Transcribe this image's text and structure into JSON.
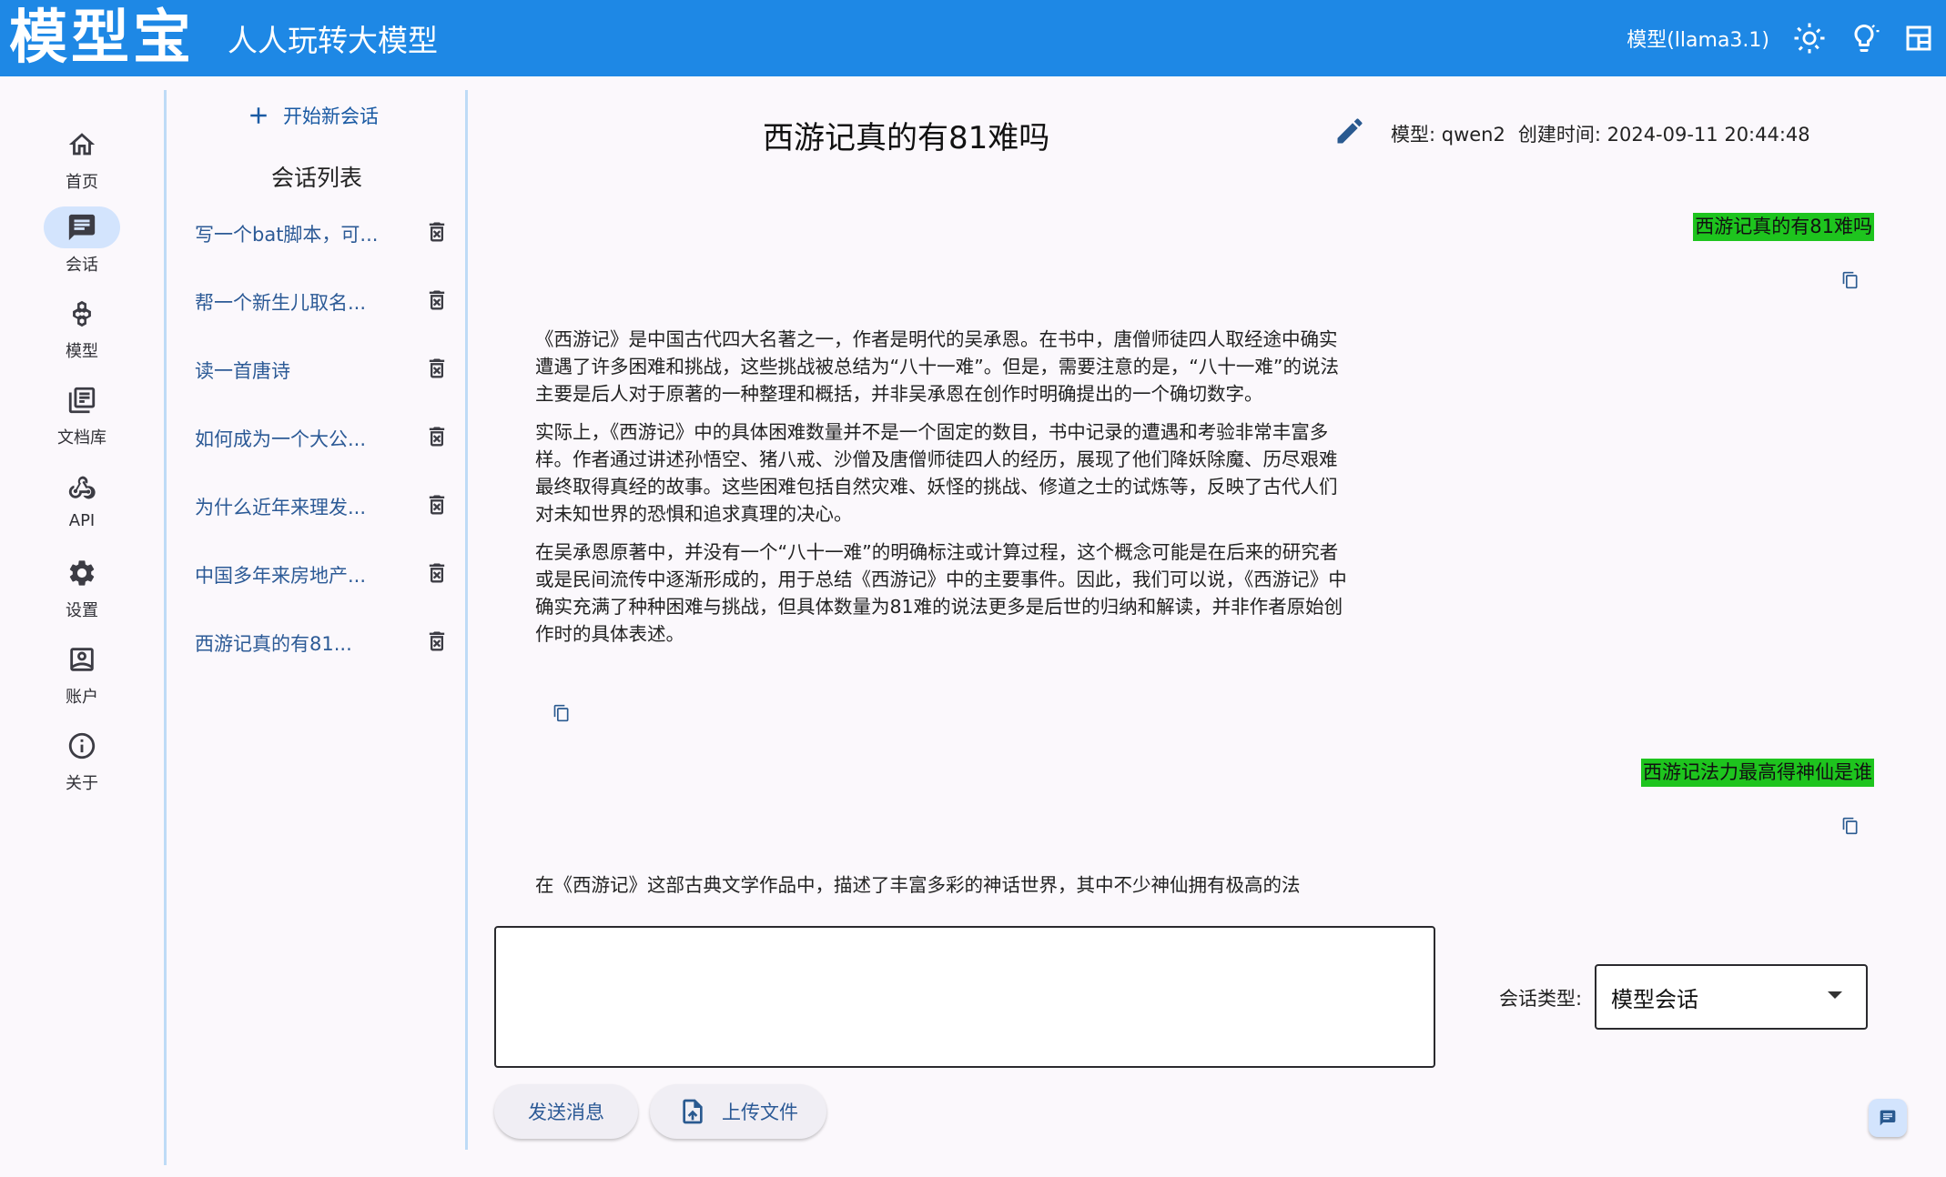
{
  "header": {
    "brand": "模型宝",
    "slogan": "人人玩转大模型",
    "model_label": "模型(llama3.1)"
  },
  "nav": {
    "items": [
      {
        "label": "首页",
        "icon": "home-icon"
      },
      {
        "label": "会话",
        "icon": "chat-icon",
        "active": true
      },
      {
        "label": "模型",
        "icon": "hub-icon"
      },
      {
        "label": "文档库",
        "icon": "library-icon"
      },
      {
        "label": "API",
        "icon": "webhook-icon"
      },
      {
        "label": "设置",
        "icon": "gear-icon"
      },
      {
        "label": "账户",
        "icon": "account-icon"
      },
      {
        "label": "关于",
        "icon": "info-icon"
      }
    ]
  },
  "conversations": {
    "new_label": "开始新会话",
    "title": "会话列表",
    "items": [
      {
        "label": "写一个bat脚本，可..."
      },
      {
        "label": "帮一个新生儿取名..."
      },
      {
        "label": "读一首唐诗"
      },
      {
        "label": "如何成为一个大公..."
      },
      {
        "label": "为什么近年来理发..."
      },
      {
        "label": "中国多年来房地产..."
      },
      {
        "label": "西游记真的有81..."
      }
    ]
  },
  "chat": {
    "title": "西游记真的有81难吗",
    "model": "模型: qwen2",
    "created": "创建时间: 2024-09-11 20:44:48",
    "messages": [
      {
        "role": "user",
        "text": "西游记真的有81难吗"
      },
      {
        "role": "assistant",
        "paragraphs": [
          "《西游记》是中国古代四大名著之一，作者是明代的吴承恩。在书中，唐僧师徒四人取经途中确实遭遇了许多困难和挑战，这些挑战被总结为“八十一难”。但是，需要注意的是，“八十一难”的说法主要是后人对于原著的一种整理和概括，并非吴承恩在创作时明确提出的一个确切数字。",
          "实际上，《西游记》中的具体困难数量并不是一个固定的数目，书中记录的遭遇和考验非常丰富多样。作者通过讲述孙悟空、猪八戒、沙僧及唐僧师徒四人的经历，展现了他们降妖除魔、历尽艰难最终取得真经的故事。这些困难包括自然灾难、妖怪的挑战、修道之士的试炼等，反映了古代人们对未知世界的恐惧和追求真理的决心。",
          "在吴承恩原著中，并没有一个“八十一难”的明确标注或计算过程，这个概念可能是在后来的研究者或是民间流传中逐渐形成的，用于总结《西游记》中的主要事件。因此，我们可以说，《西游记》中确实充满了种种困难与挑战，但具体数量为81难的说法更多是后世的归纳和解读，并非作者原始创作时的具体表述。"
        ]
      },
      {
        "role": "user",
        "text": "西游记法力最高得神仙是谁"
      },
      {
        "role": "assistant",
        "paragraphs": [
          "在《西游记》这部古典文学作品中，描述了丰富多彩的神话世界，其中不少神仙拥有极高的法"
        ]
      }
    ]
  },
  "composer": {
    "value": "",
    "placeholder": "",
    "type_label": "会话类型:",
    "type_value": "模型会话",
    "send_label": "发送消息",
    "upload_label": "上传文件"
  }
}
